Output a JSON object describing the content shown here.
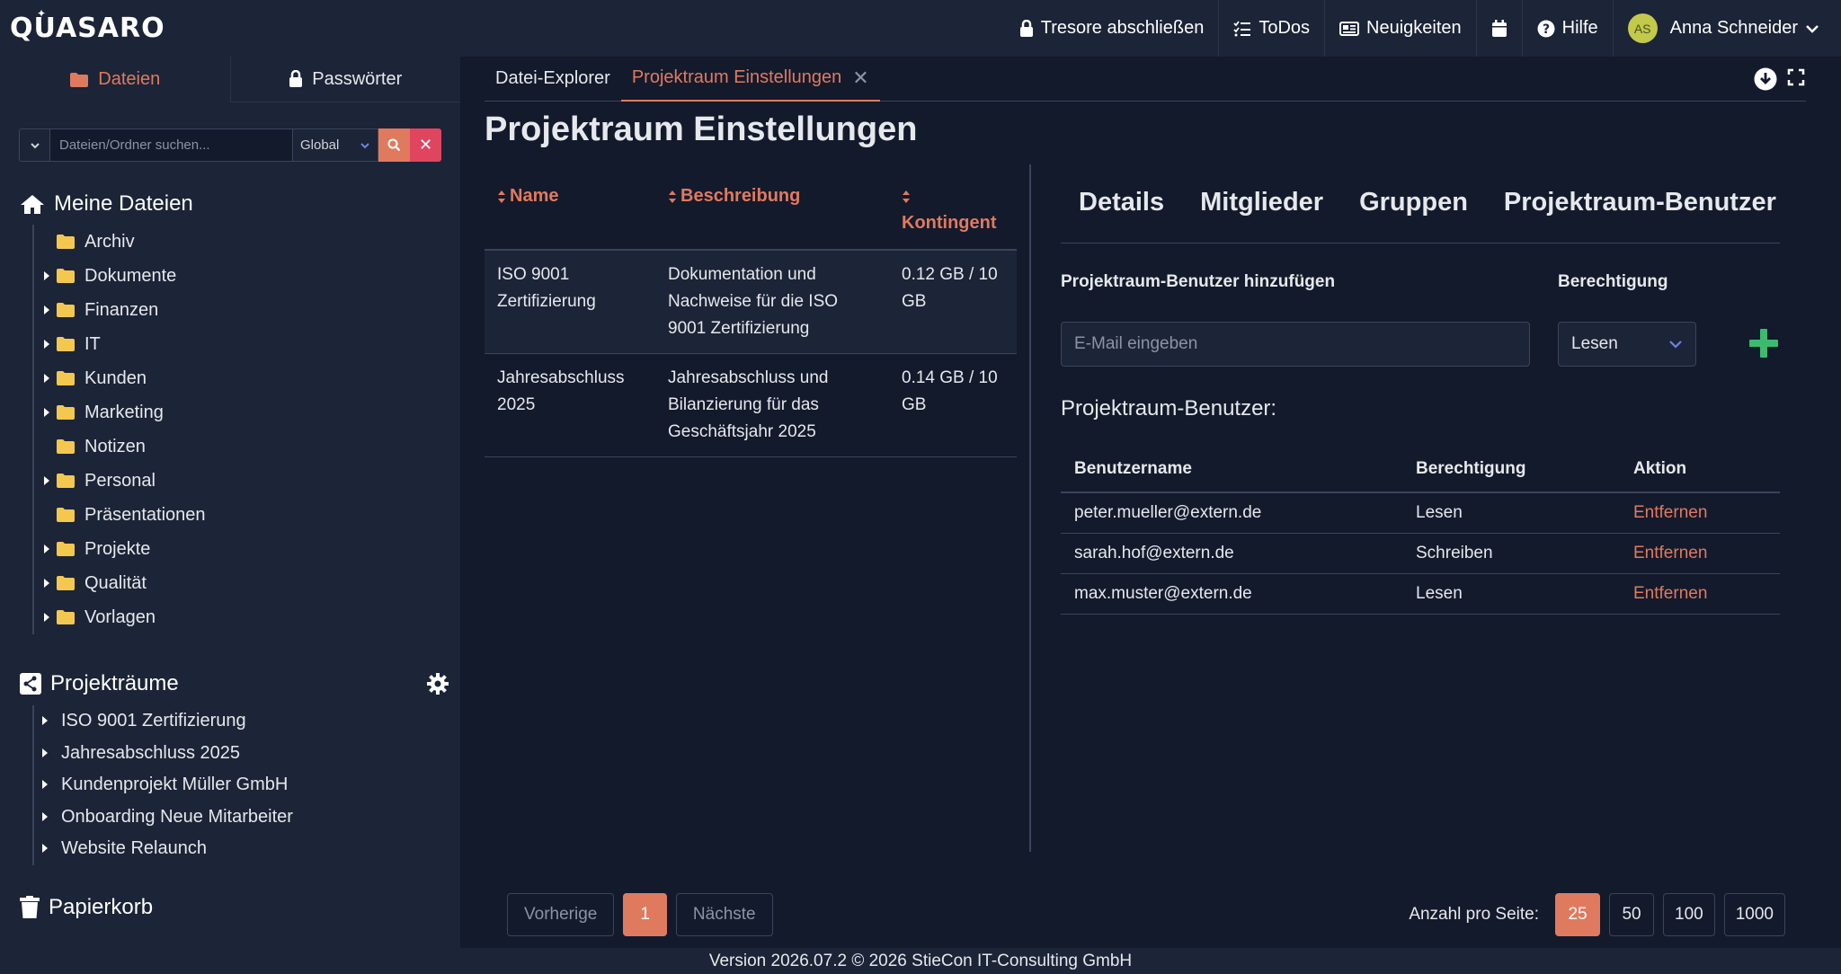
{
  "app": {
    "logo": "QUASARO"
  },
  "topnav": {
    "lock": "Tresore abschließen",
    "todos": "ToDos",
    "news": "Neuigkeiten",
    "help": "Hilfe",
    "user_initials": "AS",
    "user_name": "Anna Schneider"
  },
  "sidebar": {
    "tabs": {
      "files": "Dateien",
      "passwords": "Passwörter"
    },
    "search": {
      "placeholder": "Dateien/Ordner suchen...",
      "scope": "Global"
    },
    "my_files": {
      "title": "Meine Dateien",
      "items": [
        {
          "label": "Archiv",
          "expandable": false
        },
        {
          "label": "Dokumente",
          "expandable": true
        },
        {
          "label": "Finanzen",
          "expandable": true
        },
        {
          "label": "IT",
          "expandable": true
        },
        {
          "label": "Kunden",
          "expandable": true
        },
        {
          "label": "Marketing",
          "expandable": true
        },
        {
          "label": "Notizen",
          "expandable": false
        },
        {
          "label": "Personal",
          "expandable": true
        },
        {
          "label": "Präsentationen",
          "expandable": false
        },
        {
          "label": "Projekte",
          "expandable": true
        },
        {
          "label": "Qualität",
          "expandable": true
        },
        {
          "label": "Vorlagen",
          "expandable": true
        }
      ]
    },
    "project_rooms": {
      "title": "Projekträume",
      "items": [
        "ISO 9001 Zertifizierung",
        "Jahresabschluss 2025",
        "Kundenprojekt Müller GmbH",
        "Onboarding Neue Mitarbeiter",
        "Website Relaunch"
      ]
    },
    "trash": "Papierkorb"
  },
  "main": {
    "tabs": {
      "explorer": "Datei-Explorer",
      "settings": "Projektraum Einstellungen"
    },
    "title": "Projektraum Einstellungen",
    "rooms_table": {
      "headers": {
        "name": "Name",
        "desc": "Beschreibung",
        "quota": "Kontingent"
      },
      "rows": [
        {
          "name": "ISO 9001 Zertifizierung",
          "desc": "Dokumentation und Nachweise für die ISO 9001 Zertifizierung",
          "quota": "0.12 GB / 10 GB"
        },
        {
          "name": "Jahresabschluss 2025",
          "desc": "Jahresabschluss und Bilanzierung für das Geschäftsjahr 2025",
          "quota": "0.14 GB / 10 GB"
        }
      ]
    },
    "right_tabs": {
      "details": "Details",
      "members": "Mitglieder",
      "groups": "Gruppen",
      "room_users": "Projektraum-Benutzer"
    },
    "add_user": {
      "label": "Projektraum-Benutzer hinzufügen",
      "perm_label": "Berechtigung",
      "email_placeholder": "E-Mail eingeben",
      "perm_value": "Lesen"
    },
    "users": {
      "title": "Projektraum-Benutzer:",
      "headers": {
        "user": "Benutzername",
        "perm": "Berechtigung",
        "action": "Aktion"
      },
      "rows": [
        {
          "user": "peter.mueller@extern.de",
          "perm": "Lesen",
          "action": "Entfernen"
        },
        {
          "user": "sarah.hof@extern.de",
          "perm": "Schreiben",
          "action": "Entfernen"
        },
        {
          "user": "max.muster@extern.de",
          "perm": "Lesen",
          "action": "Entfernen"
        }
      ]
    },
    "pager": {
      "prev": "Vorherige",
      "current": "1",
      "next": "Nächste"
    },
    "per_page": {
      "label": "Anzahl pro Seite:",
      "options": [
        "25",
        "50",
        "100",
        "1000"
      ],
      "selected": "25"
    }
  },
  "footer": "Version 2026.07.2 © 2026 StieCon IT-Consulting GmbH",
  "colors": {
    "accent": "#e07a5f",
    "danger": "#e0455f",
    "success": "#3dba6f",
    "folder": "#f4c84f"
  }
}
